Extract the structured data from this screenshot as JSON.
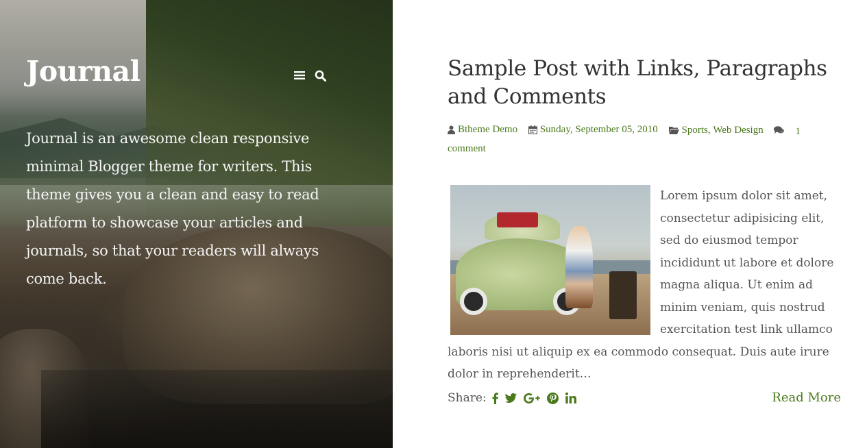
{
  "blog": {
    "title": "Journal",
    "tagline": "Journal is an awesome clean responsive minimal Blogger theme for writers. This theme gives you a clean and easy to read platform to showcase your articles and journals, so that your readers will always come back.",
    "menu_icon": "bars-icon",
    "search_icon": "search-icon"
  },
  "post": {
    "title": "Sample Post with Links, Paragraphs and Comments",
    "author": "Btheme Demo",
    "date": "Sunday, September 05, 2010",
    "labels": [
      "Sports",
      "Web Design"
    ],
    "label_separator": ",",
    "comments": "1 comment",
    "excerpt": "Lorem ipsum dolor sit amet, consectetur adipisicing elit, sed do eiusmod tempor incididunt ut labore et dolore magna aliqua. Ut enim ad minim veniam, quis nostrud exercitation test link ullamco laboris nisi ut aliquip ex ea commodo consequat. Duis aute irure dolor in reprehenderit…",
    "share_label": "Share:",
    "share_icons": [
      "facebook-icon",
      "twitter-icon",
      "google-plus-icon",
      "pinterest-icon",
      "linkedin-icon"
    ],
    "read_more": "Read More"
  },
  "colors": {
    "accent": "#4b7a1d",
    "text": "#555555",
    "title": "#333333",
    "hero_text": "#ffffff"
  }
}
